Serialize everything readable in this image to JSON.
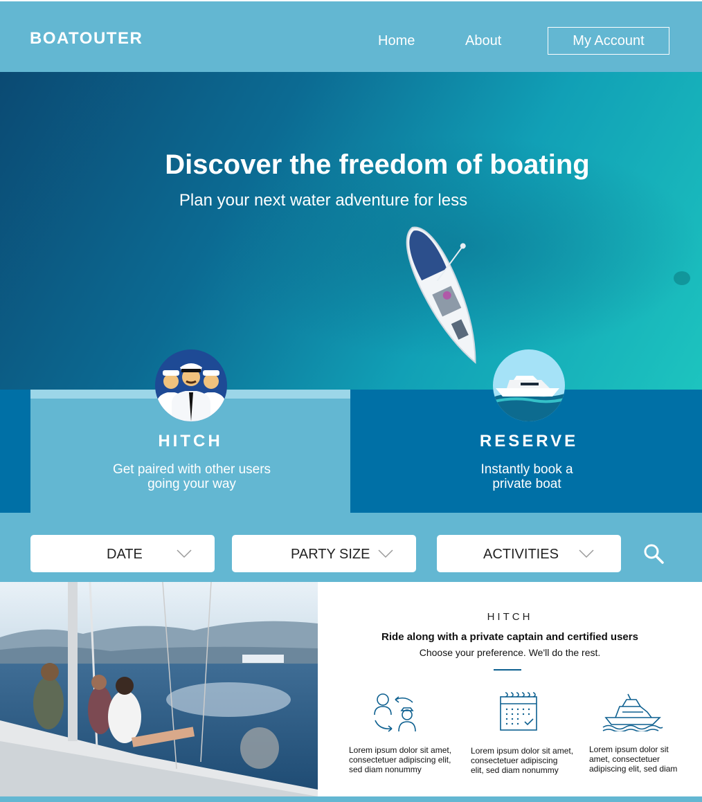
{
  "header": {
    "logo": "BOATOUTER",
    "nav": {
      "home": "Home",
      "about": "About",
      "account": "My Account"
    }
  },
  "hero": {
    "title": "Discover the freedom of boating",
    "subtitle": "Plan your next water adventure for less"
  },
  "features": {
    "hitch": {
      "title": "HITCH",
      "line1": "Get paired with other users",
      "line2": "going your way"
    },
    "reserve": {
      "title": "RESERVE",
      "line1": "Instantly book a",
      "line2": "private boat"
    }
  },
  "search": {
    "date": "DATE",
    "party_size": "PARTY SIZE",
    "activities": "ACTIVITIES"
  },
  "info": {
    "eyebrow": "HITCH",
    "headline": "Ride along with a private captain and certified users",
    "subline": "Choose your preference. We'll do the rest.",
    "items": [
      {
        "icon": "swap-users-icon",
        "line1": "Lorem ipsum dolor sit amet,",
        "line2": "consectetuer adipiscing elit,",
        "line3": "sed diam nonummy"
      },
      {
        "icon": "calendar-icon",
        "line1": "Lorem ipsum dolor sit amet,",
        "line2": "consectetuer adipiscing",
        "line3": "elit, sed diam nonummy"
      },
      {
        "icon": "boat-icon",
        "line1": "Lorem ipsum dolor sit",
        "line2": "amet, consectetuer",
        "line3": "adipiscing elit, sed diam"
      }
    ]
  },
  "colors": {
    "header_blue": "#63b7d2",
    "dark_blue": "#0070a6",
    "icon_blue": "#0c5f8f"
  }
}
